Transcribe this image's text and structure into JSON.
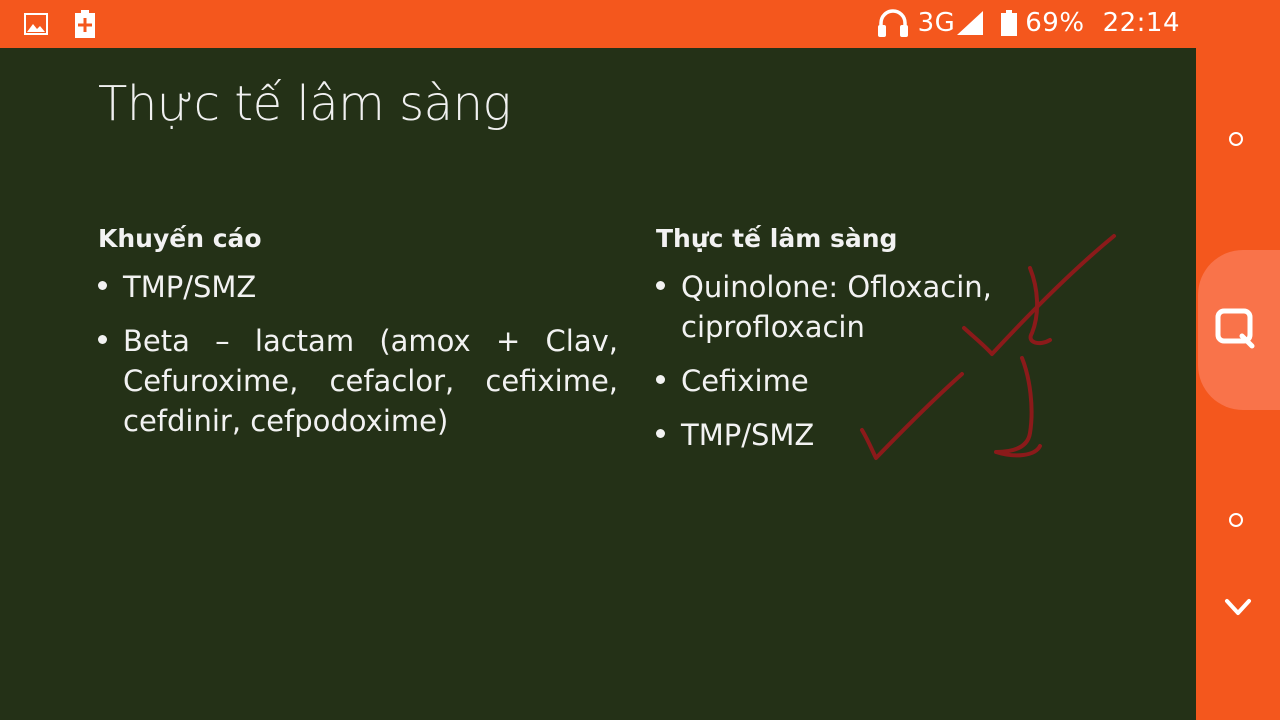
{
  "status_bar": {
    "network": "3G",
    "battery": "69%",
    "time": "22:14",
    "background": "#f4571d"
  },
  "slide": {
    "title": "Thực tế lâm sàng",
    "background": "#243117",
    "left_column": {
      "heading": "Khuyến cáo",
      "items": [
        "TMP/SMZ",
        "Beta – lactam (amox + Clav, Cefuroxime, cefaclor, cefixime, cefdinir, cefpodoxime)"
      ]
    },
    "right_column": {
      "heading": "Thực tế lâm sàng",
      "items": [
        "Quinolone: Ofloxacin, ciprofloxacin",
        "Cefixime",
        "TMP/SMZ"
      ]
    },
    "annotation_color": "#8b1a1a"
  },
  "icons": {
    "status_left": [
      "gallery-icon",
      "battery-saver-icon"
    ],
    "status_right": [
      "headset-icon",
      "signal-icon",
      "battery-icon"
    ],
    "nav": [
      "circle-icon",
      "search-icon",
      "circle-icon",
      "chevron-down-icon"
    ]
  }
}
